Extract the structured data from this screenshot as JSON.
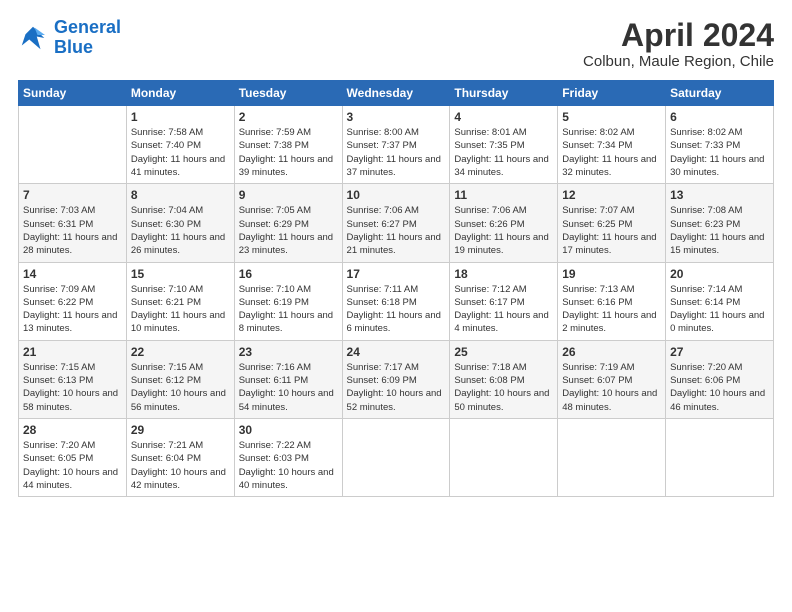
{
  "header": {
    "logo_line1": "General",
    "logo_line2": "Blue",
    "month": "April 2024",
    "location": "Colbun, Maule Region, Chile"
  },
  "weekdays": [
    "Sunday",
    "Monday",
    "Tuesday",
    "Wednesday",
    "Thursday",
    "Friday",
    "Saturday"
  ],
  "weeks": [
    [
      {
        "day": "",
        "sunrise": "",
        "sunset": "",
        "daylight": ""
      },
      {
        "day": "1",
        "sunrise": "Sunrise: 7:58 AM",
        "sunset": "Sunset: 7:40 PM",
        "daylight": "Daylight: 11 hours and 41 minutes."
      },
      {
        "day": "2",
        "sunrise": "Sunrise: 7:59 AM",
        "sunset": "Sunset: 7:38 PM",
        "daylight": "Daylight: 11 hours and 39 minutes."
      },
      {
        "day": "3",
        "sunrise": "Sunrise: 8:00 AM",
        "sunset": "Sunset: 7:37 PM",
        "daylight": "Daylight: 11 hours and 37 minutes."
      },
      {
        "day": "4",
        "sunrise": "Sunrise: 8:01 AM",
        "sunset": "Sunset: 7:35 PM",
        "daylight": "Daylight: 11 hours and 34 minutes."
      },
      {
        "day": "5",
        "sunrise": "Sunrise: 8:02 AM",
        "sunset": "Sunset: 7:34 PM",
        "daylight": "Daylight: 11 hours and 32 minutes."
      },
      {
        "day": "6",
        "sunrise": "Sunrise: 8:02 AM",
        "sunset": "Sunset: 7:33 PM",
        "daylight": "Daylight: 11 hours and 30 minutes."
      }
    ],
    [
      {
        "day": "7",
        "sunrise": "Sunrise: 7:03 AM",
        "sunset": "Sunset: 6:31 PM",
        "daylight": "Daylight: 11 hours and 28 minutes."
      },
      {
        "day": "8",
        "sunrise": "Sunrise: 7:04 AM",
        "sunset": "Sunset: 6:30 PM",
        "daylight": "Daylight: 11 hours and 26 minutes."
      },
      {
        "day": "9",
        "sunrise": "Sunrise: 7:05 AM",
        "sunset": "Sunset: 6:29 PM",
        "daylight": "Daylight: 11 hours and 23 minutes."
      },
      {
        "day": "10",
        "sunrise": "Sunrise: 7:06 AM",
        "sunset": "Sunset: 6:27 PM",
        "daylight": "Daylight: 11 hours and 21 minutes."
      },
      {
        "day": "11",
        "sunrise": "Sunrise: 7:06 AM",
        "sunset": "Sunset: 6:26 PM",
        "daylight": "Daylight: 11 hours and 19 minutes."
      },
      {
        "day": "12",
        "sunrise": "Sunrise: 7:07 AM",
        "sunset": "Sunset: 6:25 PM",
        "daylight": "Daylight: 11 hours and 17 minutes."
      },
      {
        "day": "13",
        "sunrise": "Sunrise: 7:08 AM",
        "sunset": "Sunset: 6:23 PM",
        "daylight": "Daylight: 11 hours and 15 minutes."
      }
    ],
    [
      {
        "day": "14",
        "sunrise": "Sunrise: 7:09 AM",
        "sunset": "Sunset: 6:22 PM",
        "daylight": "Daylight: 11 hours and 13 minutes."
      },
      {
        "day": "15",
        "sunrise": "Sunrise: 7:10 AM",
        "sunset": "Sunset: 6:21 PM",
        "daylight": "Daylight: 11 hours and 10 minutes."
      },
      {
        "day": "16",
        "sunrise": "Sunrise: 7:10 AM",
        "sunset": "Sunset: 6:19 PM",
        "daylight": "Daylight: 11 hours and 8 minutes."
      },
      {
        "day": "17",
        "sunrise": "Sunrise: 7:11 AM",
        "sunset": "Sunset: 6:18 PM",
        "daylight": "Daylight: 11 hours and 6 minutes."
      },
      {
        "day": "18",
        "sunrise": "Sunrise: 7:12 AM",
        "sunset": "Sunset: 6:17 PM",
        "daylight": "Daylight: 11 hours and 4 minutes."
      },
      {
        "day": "19",
        "sunrise": "Sunrise: 7:13 AM",
        "sunset": "Sunset: 6:16 PM",
        "daylight": "Daylight: 11 hours and 2 minutes."
      },
      {
        "day": "20",
        "sunrise": "Sunrise: 7:14 AM",
        "sunset": "Sunset: 6:14 PM",
        "daylight": "Daylight: 11 hours and 0 minutes."
      }
    ],
    [
      {
        "day": "21",
        "sunrise": "Sunrise: 7:15 AM",
        "sunset": "Sunset: 6:13 PM",
        "daylight": "Daylight: 10 hours and 58 minutes."
      },
      {
        "day": "22",
        "sunrise": "Sunrise: 7:15 AM",
        "sunset": "Sunset: 6:12 PM",
        "daylight": "Daylight: 10 hours and 56 minutes."
      },
      {
        "day": "23",
        "sunrise": "Sunrise: 7:16 AM",
        "sunset": "Sunset: 6:11 PM",
        "daylight": "Daylight: 10 hours and 54 minutes."
      },
      {
        "day": "24",
        "sunrise": "Sunrise: 7:17 AM",
        "sunset": "Sunset: 6:09 PM",
        "daylight": "Daylight: 10 hours and 52 minutes."
      },
      {
        "day": "25",
        "sunrise": "Sunrise: 7:18 AM",
        "sunset": "Sunset: 6:08 PM",
        "daylight": "Daylight: 10 hours and 50 minutes."
      },
      {
        "day": "26",
        "sunrise": "Sunrise: 7:19 AM",
        "sunset": "Sunset: 6:07 PM",
        "daylight": "Daylight: 10 hours and 48 minutes."
      },
      {
        "day": "27",
        "sunrise": "Sunrise: 7:20 AM",
        "sunset": "Sunset: 6:06 PM",
        "daylight": "Daylight: 10 hours and 46 minutes."
      }
    ],
    [
      {
        "day": "28",
        "sunrise": "Sunrise: 7:20 AM",
        "sunset": "Sunset: 6:05 PM",
        "daylight": "Daylight: 10 hours and 44 minutes."
      },
      {
        "day": "29",
        "sunrise": "Sunrise: 7:21 AM",
        "sunset": "Sunset: 6:04 PM",
        "daylight": "Daylight: 10 hours and 42 minutes."
      },
      {
        "day": "30",
        "sunrise": "Sunrise: 7:22 AM",
        "sunset": "Sunset: 6:03 PM",
        "daylight": "Daylight: 10 hours and 40 minutes."
      },
      {
        "day": "",
        "sunrise": "",
        "sunset": "",
        "daylight": ""
      },
      {
        "day": "",
        "sunrise": "",
        "sunset": "",
        "daylight": ""
      },
      {
        "day": "",
        "sunrise": "",
        "sunset": "",
        "daylight": ""
      },
      {
        "day": "",
        "sunrise": "",
        "sunset": "",
        "daylight": ""
      }
    ]
  ]
}
